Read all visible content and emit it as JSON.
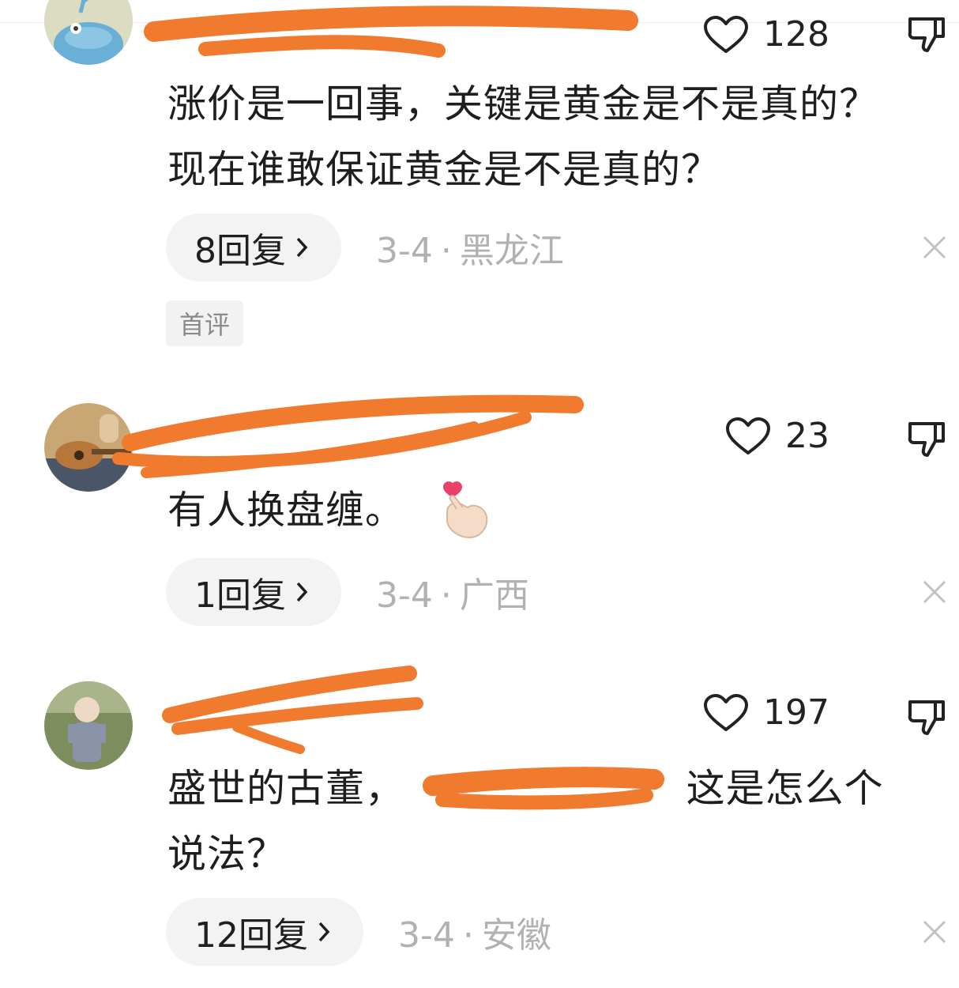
{
  "comments": [
    {
      "username": "",
      "likes": "128",
      "text": "涨价是一回事，关键是黄金是不是真的？\n现在谁敢保证黄金是不是真的？",
      "replies": "8回复",
      "date": "3-4",
      "location": "黑龙江",
      "badge": "首评"
    },
    {
      "username": "",
      "likes": "23",
      "text": "有人换盘缠。",
      "emoji": "finger-heart-emoji",
      "replies": "1回复",
      "date": "3-4",
      "location": "广西"
    },
    {
      "username": "",
      "likes": "197",
      "text_part1": "盛世的古董，",
      "text_part2": "！ 这是怎么个",
      "text_line2": "说法？",
      "replies": "12回复",
      "date": "3-4",
      "location": "安徽"
    }
  ],
  "separator": "·",
  "colors": {
    "redaction": "#f07a2e",
    "meta_text": "#b1b1b1",
    "pill_bg": "#f3f3f3"
  },
  "icons": {
    "like": "heart-outline-icon",
    "dislike": "thumbs-down-icon",
    "reply_chevron": "chevron-right-icon",
    "dismiss": "close-icon"
  }
}
